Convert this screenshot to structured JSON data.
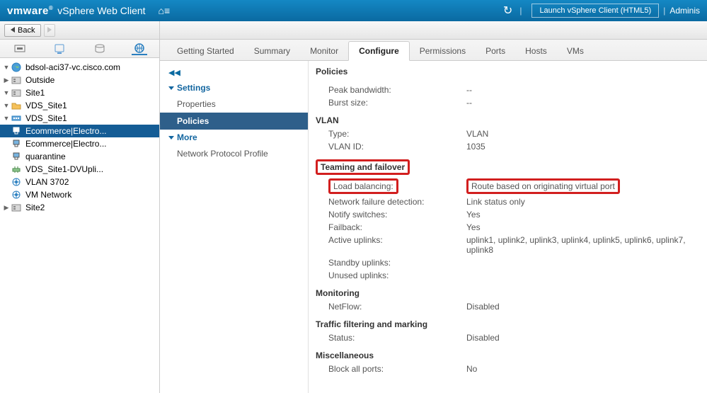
{
  "hdr": {
    "brand": "vmware",
    "sub": "vSphere Web Client",
    "home": "⌂≡",
    "refresh": "↻",
    "launch": "Launch vSphere Client (HTML5)",
    "user": "Adminis"
  },
  "nav": {
    "back": "Back"
  },
  "tree": [
    {
      "lv": 0,
      "tw": "▼",
      "icon": "earth",
      "label": "bdsol-aci37-vc.cisco.com",
      "sel": false
    },
    {
      "lv": 1,
      "tw": "▶",
      "icon": "dc",
      "label": "Outside"
    },
    {
      "lv": 1,
      "tw": "▼",
      "icon": "dc",
      "label": "Site1"
    },
    {
      "lv": 2,
      "tw": "▼",
      "icon": "folder",
      "label": "VDS_Site1"
    },
    {
      "lv": 3,
      "tw": "▼",
      "icon": "dvs",
      "label": "VDS_Site1"
    },
    {
      "lv": 4,
      "tw": "",
      "icon": "pg",
      "label": "Ecommerce|Electro...",
      "sel": true
    },
    {
      "lv": 4,
      "tw": "",
      "icon": "pg",
      "label": "Ecommerce|Electro..."
    },
    {
      "lv": 4,
      "tw": "",
      "icon": "pg",
      "label": "quarantine"
    },
    {
      "lv": 4,
      "tw": "",
      "icon": "upl",
      "label": "VDS_Site1-DVUpli..."
    },
    {
      "lv": 2,
      "tw": "",
      "icon": "net",
      "label": "VLAN 3702"
    },
    {
      "lv": 2,
      "tw": "",
      "icon": "net",
      "label": "VM Network"
    },
    {
      "lv": 1,
      "tw": "▶",
      "icon": "dc",
      "label": "Site2"
    }
  ],
  "tabs": [
    "Getting Started",
    "Summary",
    "Monitor",
    "Configure",
    "Permissions",
    "Ports",
    "Hosts",
    "VMs"
  ],
  "tabActive": 3,
  "cfgnav": [
    {
      "t": "collapse",
      "label": "◀◀"
    },
    {
      "t": "grp",
      "label": "Settings"
    },
    {
      "t": "itm",
      "label": "Properties"
    },
    {
      "t": "itm",
      "label": "Policies",
      "act": true
    },
    {
      "t": "grp",
      "label": "More"
    },
    {
      "t": "itm",
      "label": "Network Protocol Profile"
    }
  ],
  "policies": {
    "title": "Policies",
    "sections": [
      {
        "rows": [
          [
            "Peak bandwidth:",
            "--"
          ],
          [
            "Burst size:",
            "--"
          ]
        ]
      },
      {
        "head": "VLAN",
        "rows": [
          [
            "Type:",
            "VLAN"
          ],
          [
            "VLAN ID:",
            "1035"
          ]
        ]
      },
      {
        "head": "Teaming and failover",
        "headbox": true,
        "rows": [
          [
            "Load balancing:",
            "Route based on originating virtual port",
            "box"
          ],
          [
            "Network failure detection:",
            "Link status only"
          ],
          [
            "Notify switches:",
            "Yes"
          ],
          [
            "Failback:",
            "Yes"
          ],
          [
            "Active uplinks:",
            "uplink1, uplink2, uplink3, uplink4, uplink5, uplink6, uplink7, uplink8"
          ],
          [
            "Standby uplinks:",
            ""
          ],
          [
            "Unused uplinks:",
            ""
          ]
        ]
      },
      {
        "head": "Monitoring",
        "rows": [
          [
            "NetFlow:",
            "Disabled"
          ]
        ]
      },
      {
        "head": "Traffic filtering and marking",
        "rows": [
          [
            "Status:",
            "Disabled"
          ]
        ]
      },
      {
        "head": "Miscellaneous",
        "rows": [
          [
            "Block all ports:",
            "No"
          ]
        ]
      }
    ]
  }
}
